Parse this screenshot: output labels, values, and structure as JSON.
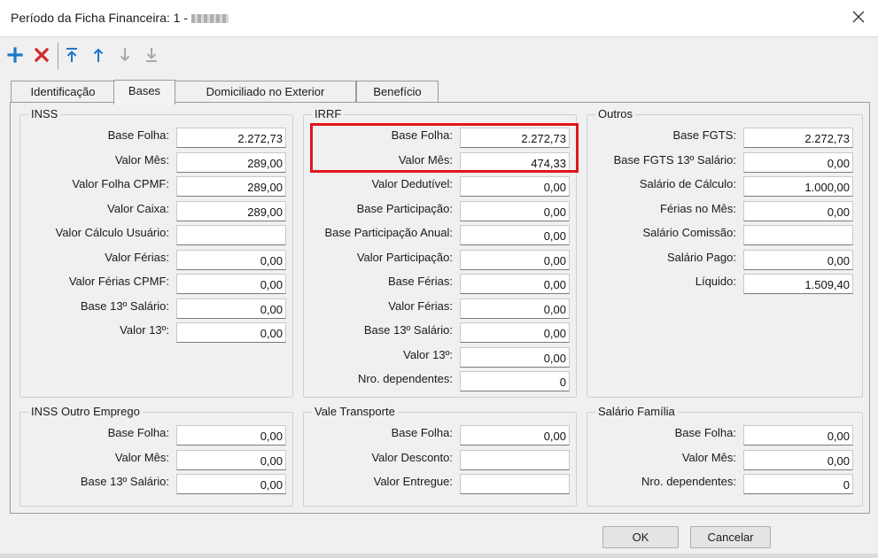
{
  "window": {
    "title": "Período da Ficha Financeira: 1 -",
    "title_redacted": true,
    "close_icon": "close-icon"
  },
  "toolbar": {
    "buttons": [
      {
        "name": "add-button",
        "icon": "plus-icon",
        "color": "#1e78c8"
      },
      {
        "name": "delete-button",
        "icon": "x-icon",
        "color": "#d22a2a"
      },
      {
        "name": "move-first-button",
        "icon": "arrow-top-icon",
        "color": "#1e78c8"
      },
      {
        "name": "move-up-button",
        "icon": "arrow-up-icon",
        "color": "#1e78c8"
      },
      {
        "name": "move-down-button",
        "icon": "arrow-down-icon",
        "color": "#a8a8a8"
      },
      {
        "name": "move-last-button",
        "icon": "arrow-bottom-icon",
        "color": "#a8a8a8"
      }
    ]
  },
  "tabs": [
    {
      "label": "Identificação",
      "active": false
    },
    {
      "label": "Bases",
      "active": true
    },
    {
      "label": "Domiciliado no Exterior",
      "active": false
    },
    {
      "label": "Benefício",
      "active": false
    }
  ],
  "groups": {
    "inss": {
      "title": "INSS",
      "rows": [
        {
          "label": "Base Folha:",
          "value": "2.272,73"
        },
        {
          "label": "Valor Mês:",
          "value": "289,00"
        },
        {
          "label": "Valor Folha CPMF:",
          "value": "289,00"
        },
        {
          "label": "Valor Caixa:",
          "value": "289,00"
        },
        {
          "label": "Valor Cálculo Usuário:",
          "value": ""
        },
        {
          "label": "Valor Férias:",
          "value": "0,00"
        },
        {
          "label": "Valor Férias CPMF:",
          "value": "0,00"
        },
        {
          "label": "Base 13º Salário:",
          "value": "0,00"
        },
        {
          "label": "Valor 13º:",
          "value": "0,00"
        }
      ]
    },
    "irrf": {
      "title": "IRRF",
      "rows": [
        {
          "label": "Base Folha:",
          "value": "2.272,73"
        },
        {
          "label": "Valor Mês:",
          "value": "474,33"
        },
        {
          "label": "Valor Dedutível:",
          "value": "0,00"
        },
        {
          "label": "Base Participação:",
          "value": "0,00"
        },
        {
          "label": "Base Participação Anual:",
          "value": "0,00"
        },
        {
          "label": "Valor Participação:",
          "value": "0,00"
        },
        {
          "label": "Base Férias:",
          "value": "0,00"
        },
        {
          "label": "Valor Férias:",
          "value": "0,00"
        },
        {
          "label": "Base 13º Salário:",
          "value": "0,00"
        },
        {
          "label": "Valor 13º:",
          "value": "0,00"
        },
        {
          "label": "Nro. dependentes:",
          "value": "0"
        }
      ]
    },
    "outros": {
      "title": "Outros",
      "rows": [
        {
          "label": "Base FGTS:",
          "value": "2.272,73"
        },
        {
          "label": "Base FGTS 13º Salário:",
          "value": "0,00"
        },
        {
          "label": "Salário de Cálculo:",
          "value": "1.000,00"
        },
        {
          "label": "Férias no Mês:",
          "value": "0,00"
        },
        {
          "label": "Salário Comissão:",
          "value": ""
        },
        {
          "label": "Salário Pago:",
          "value": "0,00"
        },
        {
          "label": "Líquido:",
          "value": "1.509,40"
        }
      ]
    },
    "inss_outro": {
      "title": "INSS Outro Emprego",
      "rows": [
        {
          "label": "Base Folha:",
          "value": "0,00"
        },
        {
          "label": "Valor Mês:",
          "value": "0,00"
        },
        {
          "label": "Base 13º Salário:",
          "value": "0,00"
        }
      ]
    },
    "vale_transporte": {
      "title": "Vale Transporte",
      "rows": [
        {
          "label": "Base Folha:",
          "value": "0,00"
        },
        {
          "label": "Valor Desconto:",
          "value": ""
        },
        {
          "label": "Valor Entregue:",
          "value": ""
        }
      ]
    },
    "salario_familia": {
      "title": "Salário Família",
      "rows": [
        {
          "label": "Base Folha:",
          "value": "0,00"
        },
        {
          "label": "Valor Mês:",
          "value": "0,00"
        },
        {
          "label": "Nro. dependentes:",
          "value": "0"
        }
      ]
    }
  },
  "highlight_color": "#e0161c",
  "footer": {
    "ok_label": "OK",
    "cancel_label": "Cancelar"
  }
}
